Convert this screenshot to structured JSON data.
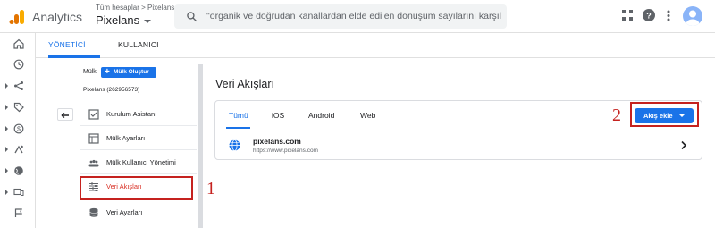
{
  "header": {
    "app_name": "Analytics",
    "breadcrumb": "Tüm hesaplar > Pixelans",
    "property_name": "Pixelans",
    "search_text": "\"organik ve doğrudan kanallardan elde edilen dönüşüm sayılarını karşılaşt..."
  },
  "top_tabs": [
    {
      "label": "YÖNETİCİ",
      "active": true
    },
    {
      "label": "KULLANICI",
      "active": false
    }
  ],
  "admin": {
    "property_label": "Mülk",
    "create_button": "Mülk Oluştur",
    "account_id": "Pixelans (262956573)",
    "menu": [
      {
        "label": "Kurulum Asistanı",
        "icon": "checkbox-icon",
        "active": false
      },
      {
        "label": "Mülk Ayarları",
        "icon": "property-settings-icon",
        "active": false
      },
      {
        "label": "Mülk Kullanıcı Yönetimi",
        "icon": "users-icon",
        "active": false
      },
      {
        "label": "Veri Akışları",
        "icon": "data-streams-icon",
        "active": true
      },
      {
        "label": "Veri Ayarları",
        "icon": "database-icon",
        "active": false
      }
    ]
  },
  "streams": {
    "title": "Veri Akışları",
    "tabs": [
      {
        "label": "Tümü",
        "active": true
      },
      {
        "label": "iOS",
        "active": false
      },
      {
        "label": "Android",
        "active": false
      },
      {
        "label": "Web",
        "active": false
      }
    ],
    "add_button": "Akış ekle",
    "items": [
      {
        "name": "pixelans.com",
        "url": "https://www.pixelans.com",
        "icon": "globe-icon"
      }
    ]
  },
  "annotations": {
    "step1": "1",
    "step2": "2"
  },
  "colors": {
    "accent": "#1a73e8",
    "annotation_red": "#c5221f",
    "logo_orange": "#f9ab00",
    "logo_dark": "#e37400"
  },
  "left_rail_icons": [
    "home-icon",
    "clock-icon",
    "explore-icon",
    "tag-icon",
    "monetization-icon",
    "retention-icon",
    "globe-icon",
    "devices-icon",
    "flag-icon"
  ]
}
